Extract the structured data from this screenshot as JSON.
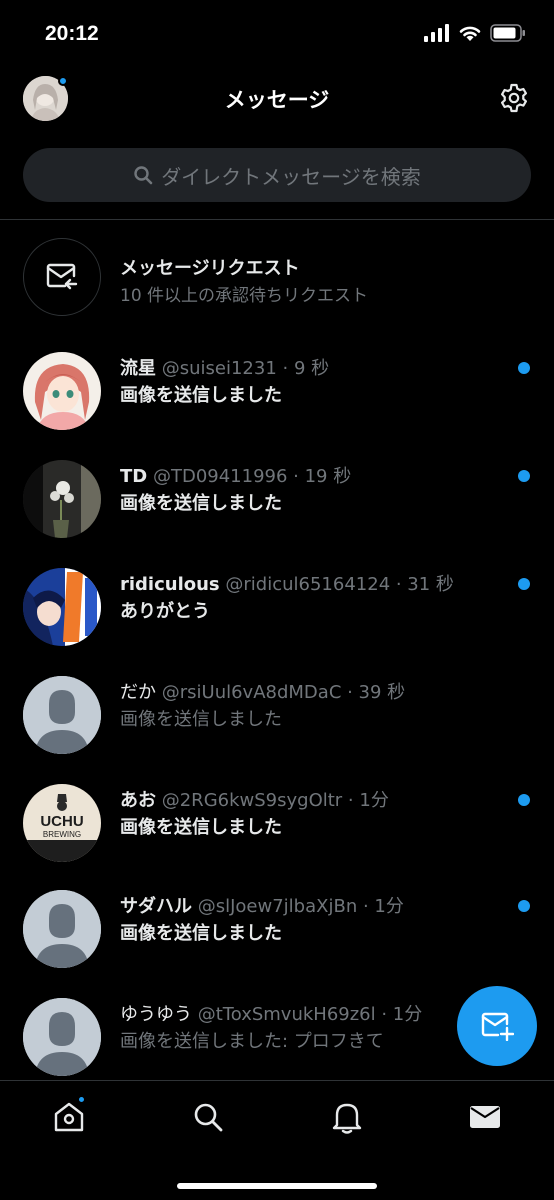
{
  "status_bar": {
    "time": "20:12"
  },
  "header": {
    "title": "メッセージ"
  },
  "search": {
    "placeholder": "ダイレクトメッセージを検索"
  },
  "request": {
    "title": "メッセージリクエスト",
    "subtitle": "10 件以上の承認待ちリクエスト"
  },
  "conversations": [
    {
      "name": "流星",
      "handle": "@suisei1231 · 9 秒",
      "message": "画像を送信しました",
      "unread": true
    },
    {
      "name": "TD",
      "handle": "@TD09411996 · 19 秒",
      "message": "画像を送信しました",
      "unread": true
    },
    {
      "name": "ridiculous",
      "handle": "@ridicul65164124 · 31 秒",
      "message": "ありがとう",
      "unread": true
    },
    {
      "name": "だか",
      "handle": "@rsiUul6vA8dMDaC · 39 秒",
      "message": "画像を送信しました",
      "unread": false
    },
    {
      "name": "あお",
      "handle": "@2RG6kwS9sygOltr · 1分",
      "message": "画像を送信しました",
      "unread": true
    },
    {
      "name": "サダハル",
      "handle": "@slJoew7jlbaXjBn · 1分",
      "message": "画像を送信しました",
      "unread": true
    },
    {
      "name": "ゆうゆう",
      "handle": "@tToxSmvukH69z6l · 1分",
      "message": "画像を送信しました: プロフきて",
      "unread": false
    }
  ],
  "avatar_logo": {
    "line1": "UCHU",
    "line2": "BREWING"
  },
  "colors": {
    "accent": "#1d9bf0",
    "background": "#000000",
    "muted": "#71767b"
  },
  "icons": [
    "gear-icon",
    "search-icon",
    "mail-request-icon",
    "new-message-icon",
    "home-icon",
    "bell-icon",
    "mail-icon"
  ]
}
